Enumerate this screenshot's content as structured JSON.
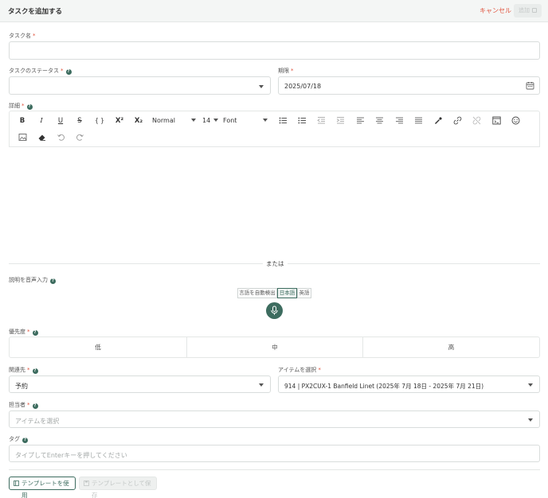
{
  "header": {
    "title": "タスクを追加する",
    "cancel_label": "キャンセル",
    "submit_label": "追加"
  },
  "task_name": {
    "label": "タスク名",
    "value": ""
  },
  "status": {
    "label": "タスクのステータス",
    "value": ""
  },
  "due": {
    "label": "期限",
    "value": "2025/07/18"
  },
  "details": {
    "label": "詳細",
    "toolbar": {
      "bold": "B",
      "italic": "I",
      "underline": "U",
      "strike": "S",
      "code": "{ }",
      "superscript": "X²",
      "subscript": "X₂",
      "heading": "Normal",
      "size": "14",
      "font": "Font"
    }
  },
  "or_label": "または",
  "voice": {
    "label": "説明を音声入力",
    "languages": [
      "言語を自動検出",
      "日本語",
      "英語"
    ],
    "active_language": "日本語"
  },
  "priority": {
    "label": "優先度",
    "options": [
      "低",
      "中",
      "高"
    ]
  },
  "related": {
    "label": "関連先",
    "value": "予約"
  },
  "item": {
    "label": "アイテムを選択",
    "value": "914 | PX2CUX-1 Banfield Linet (2025年 7月 18日 - 2025年 7月 21日)"
  },
  "assignee": {
    "label": "担当者",
    "placeholder": "アイテムを選択"
  },
  "tags": {
    "label": "タグ",
    "placeholder": "タイプしてEnterキーを押してください"
  },
  "footer": {
    "use_template_label": "テンプレートを使用",
    "save_template_label": "テンプレートとして保存"
  },
  "colors": {
    "accent": "#3d6c5f",
    "danger": "#e0533d"
  }
}
